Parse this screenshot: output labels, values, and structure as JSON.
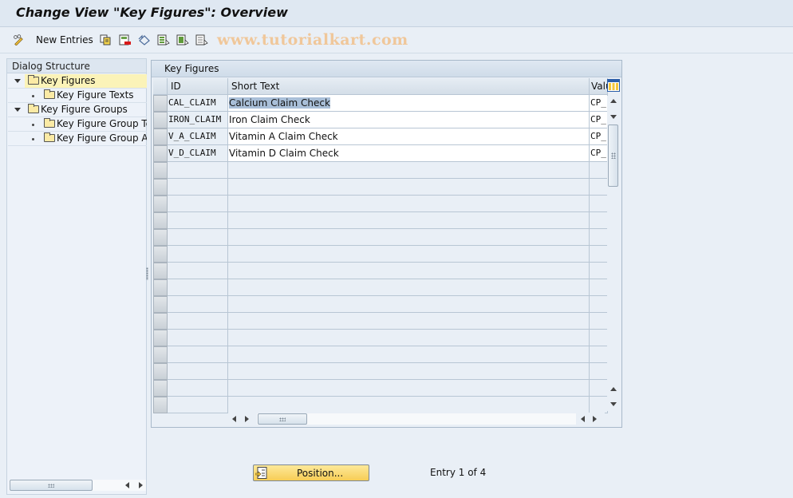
{
  "window": {
    "title": "Change View \"Key Figures\": Overview"
  },
  "toolbar": {
    "items": [
      {
        "icon": "edit-glasses-icon",
        "label": ""
      },
      {
        "icon": "new-entries",
        "label": "New Entries"
      },
      {
        "icon": "copy-icon",
        "label": ""
      },
      {
        "icon": "delete-icon",
        "label": ""
      },
      {
        "icon": "undo-icon",
        "label": ""
      },
      {
        "icon": "select-all-icon",
        "label": ""
      },
      {
        "icon": "select-block-icon",
        "label": ""
      },
      {
        "icon": "deselect-all-icon",
        "label": ""
      }
    ],
    "new_entries_label": "New Entries",
    "watermark": "www.tutorialkart.com"
  },
  "dialog_structure": {
    "header": "Dialog Structure",
    "items": [
      {
        "label": "Key Figures",
        "level": 0,
        "expanded": true,
        "selected": true
      },
      {
        "label": "Key Figure Texts",
        "level": 1
      },
      {
        "label": "Key Figure Groups",
        "level": 0,
        "expanded": true
      },
      {
        "label": "Key Figure Group Te",
        "level": 1
      },
      {
        "label": "Key Figure Group As",
        "level": 1
      }
    ]
  },
  "table": {
    "title": "Key Figures",
    "columns": [
      "ID",
      "Short Text",
      "Valu"
    ],
    "rows": [
      {
        "id": "CAL_CLAIM",
        "short_text": "Calcium Claim Check",
        "value": "CP_"
      },
      {
        "id": "IRON_CLAIM",
        "short_text": "Iron Claim Check",
        "value": "CP_"
      },
      {
        "id": "V_A_CLAIM",
        "short_text": "Vitamin A Claim Check",
        "value": "CP_"
      },
      {
        "id": "V_D_CLAIM",
        "short_text": "Vitamin D Claim Check",
        "value": "CP_"
      }
    ],
    "empty_rows": 15
  },
  "footer": {
    "position_button": "Position...",
    "entry_info": "Entry 1 of 4"
  }
}
